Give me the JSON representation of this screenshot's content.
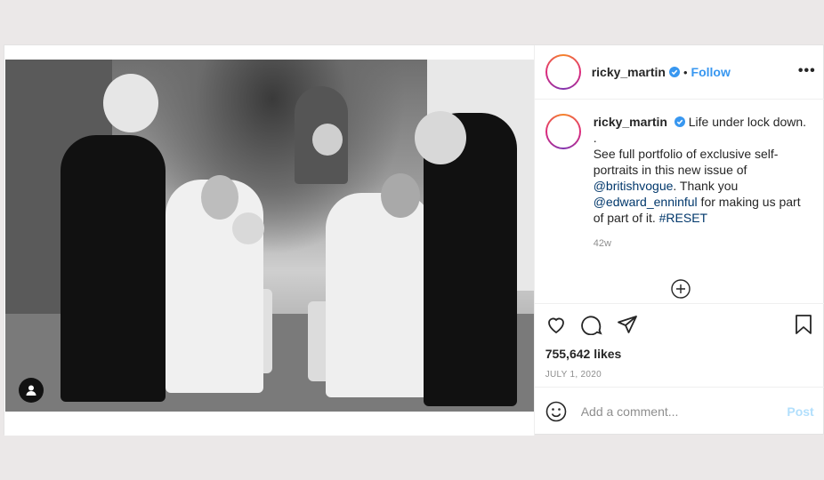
{
  "post": {
    "username": "ricky_martin",
    "dot": "•",
    "follow_label": "Follow",
    "more_label": "•••",
    "verified_icon": "verified-badge-icon",
    "caption": {
      "username": "ricky_martin",
      "line1": "Life under lock down.",
      "line2": ".",
      "line3": "See full portfolio of exclusive self-portraits in this new issue of",
      "mention1": "@britishvogue",
      "line4": ". Thank you",
      "mention2": "@edward_enninful",
      "line5": " for making us part of part of it.",
      "hashtag": "#RESET"
    },
    "comment_time": "42w",
    "likes": "755,642 likes",
    "date": "JULY 1, 2020",
    "add_comment_placeholder": "Add a comment...",
    "post_label": "Post"
  },
  "colors": {
    "accent": "#3897f0",
    "link": "#00376b",
    "muted": "#8e8e8e",
    "post_disabled": "#b2dffc"
  }
}
